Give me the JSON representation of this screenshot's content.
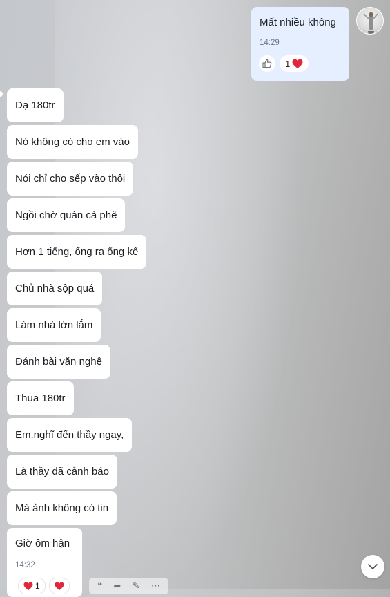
{
  "outgoing": {
    "text": "Mất nhiều không",
    "time": "14:29",
    "reaction_count": "1",
    "reaction_icon": "heart-icon",
    "avatar_icon": "avatar"
  },
  "incoming": [
    {
      "text": "Dạ 180tr"
    },
    {
      "text": "Nó không có cho em vào"
    },
    {
      "text": "Nói chỉ cho sếp vào thôi"
    },
    {
      "text": "Ngồi chờ quán cà phê"
    },
    {
      "text": "Hơn 1 tiếng, ổng ra ổng kể"
    },
    {
      "text": "Chủ nhà sộp quá"
    },
    {
      "text": "Làm nhà lớn lắm"
    },
    {
      "text": "Đánh bài văn nghệ"
    },
    {
      "text": "Thua 180tr"
    },
    {
      "text": "Em.nghĩ đến thầy ngay,"
    },
    {
      "text": "Là thầy đã cảnh báo"
    },
    {
      "text": "Mà ảnh không có tin"
    }
  ],
  "last_incoming": {
    "text": "Giờ ôm hận",
    "time": "14:32",
    "reaction_count": "1"
  },
  "toolbar_icons": [
    "quote-icon",
    "forward-icon",
    "edit-icon",
    "more-icon"
  ],
  "colors": {
    "outgoing_bubble": "#e5efff",
    "incoming_bubble": "#ffffff",
    "heart": "#e0283c"
  }
}
